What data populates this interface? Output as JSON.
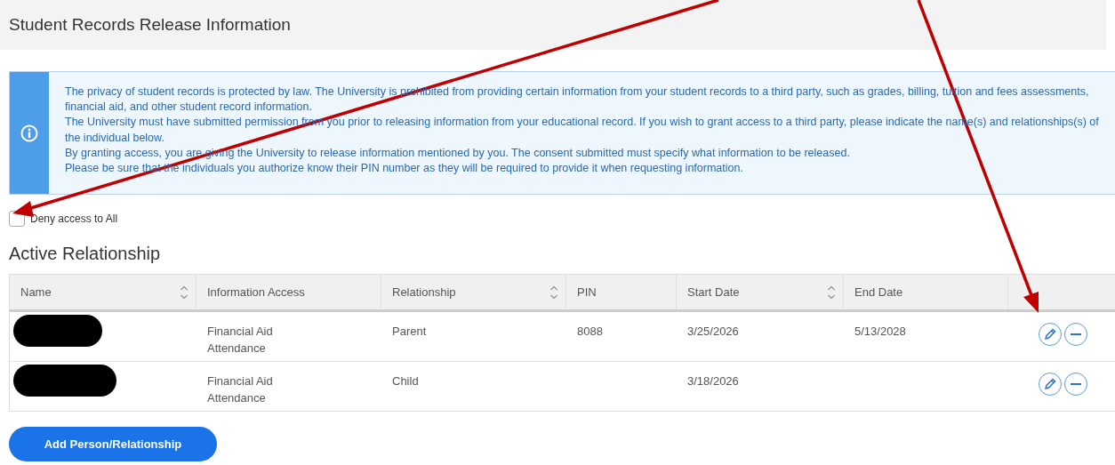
{
  "page_title": "Student Records Release Information",
  "notice": {
    "paragraphs": [
      "The privacy of student records is protected by law. The University is prohibited from providing certain information from your student records to a third party, such as grades, billing, tuition and fees assessments, financial aid, and other student record information.",
      "The University must have submitted permission from you prior to releasing information from your educational record. If you wish to grant access to a third party, please indicate the name(s) and relationships(s) of the individual below.",
      "By granting access, you are giving the University to release information mentioned by you. The consent submitted must specify what information to be released.",
      "Please be sure that the individuals you authorize know their PIN number as they will be required to provide it when requesting information."
    ]
  },
  "deny_all": {
    "label": "Deny access to All",
    "checked": false
  },
  "section_title": "Active Relationship",
  "table": {
    "columns": [
      {
        "label": "Name",
        "sortable": true
      },
      {
        "label": "Information Access",
        "sortable": false
      },
      {
        "label": "Relationship",
        "sortable": true
      },
      {
        "label": "PIN",
        "sortable": false
      },
      {
        "label": "Start Date",
        "sortable": true
      },
      {
        "label": "End Date",
        "sortable": false
      }
    ],
    "rows": [
      {
        "name_redacted": true,
        "access": [
          "Financial Aid",
          "Attendance"
        ],
        "relationship": "Parent",
        "pin": "8088",
        "start": "3/25/2026",
        "end": "5/13/2028"
      },
      {
        "name_redacted": true,
        "access": [
          "Financial Aid",
          "Attendance"
        ],
        "relationship": "Child",
        "start": "3/18/2026"
      }
    ]
  },
  "add_button": "Add Person/Relationship"
}
